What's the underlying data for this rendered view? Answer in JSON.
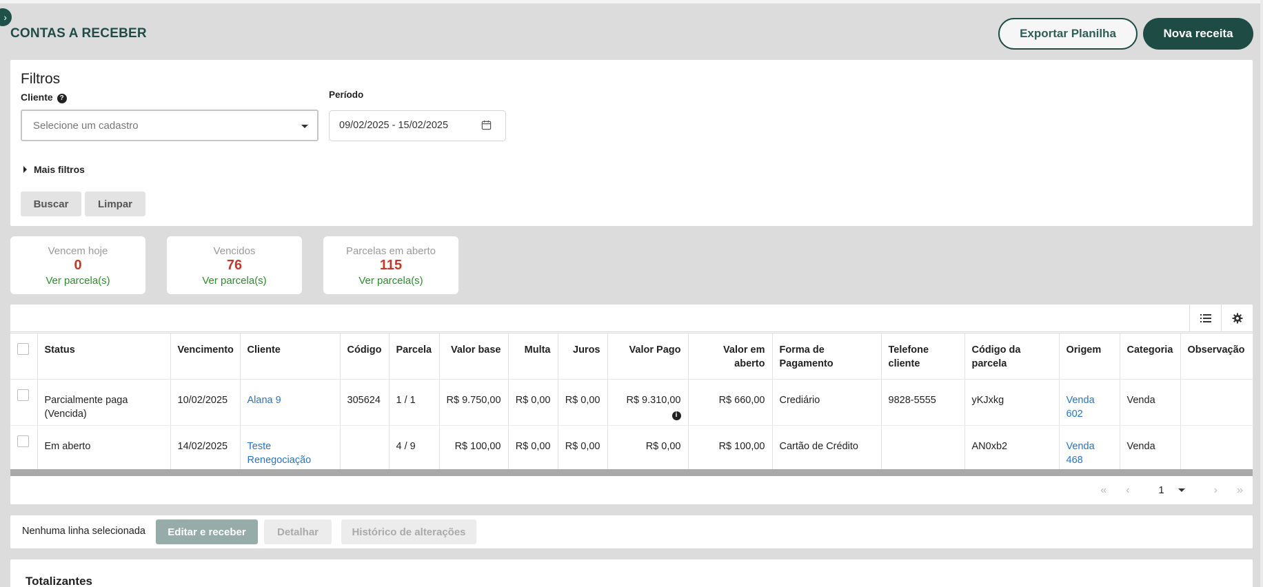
{
  "header": {
    "title": "CONTAS A RECEBER",
    "export_label": "Exportar Planilha",
    "new_label": "Nova receita"
  },
  "filters": {
    "title": "Filtros",
    "client_label": "Cliente",
    "client_placeholder": "Selecione um cadastro",
    "period_label": "Período",
    "period_value": "09/02/2025 - 15/02/2025",
    "more_filters_label": "Mais filtros",
    "search_label": "Buscar",
    "clear_label": "Limpar"
  },
  "stats": [
    {
      "label": "Vencem hoje",
      "value": "0",
      "link": "Ver parcela(s)"
    },
    {
      "label": "Vencidos",
      "value": "76",
      "link": "Ver parcela(s)"
    },
    {
      "label": "Parcelas em aberto",
      "value": "115",
      "link": "Ver parcela(s)"
    }
  ],
  "table": {
    "columns": [
      "Status",
      "Vencimento",
      "Cliente",
      "Código",
      "Parcela",
      "Valor base",
      "Multa",
      "Juros",
      "Valor Pago",
      "Valor em aberto",
      "Forma de Pagamento",
      "Telefone cliente",
      "Código da parcela",
      "Origem",
      "Categoria",
      "Observação"
    ],
    "rows": [
      {
        "status": "Parcialmente paga (Vencida)",
        "vencimento": "10/02/2025",
        "cliente": "Alana 9",
        "codigo": "305624",
        "parcela": "1 / 1",
        "valor_base": "R$ 9.750,00",
        "multa": "R$ 0,00",
        "juros": "R$ 0,00",
        "valor_pago": "R$ 9.310,00",
        "valor_aberto": "R$ 660,00",
        "forma_pagamento": "Crediário",
        "telefone": "9828-5555",
        "codigo_parcela": "yKJxkg",
        "origem": "Venda 602",
        "categoria": "Venda",
        "observacao": ""
      },
      {
        "status": "Em aberto",
        "vencimento": "14/02/2025",
        "cliente": "Teste Renegociação",
        "codigo": "",
        "parcela": "4 / 9",
        "valor_base": "R$ 100,00",
        "multa": "R$ 0,00",
        "juros": "R$ 0,00",
        "valor_pago": "R$ 0,00",
        "valor_aberto": "R$ 100,00",
        "forma_pagamento": "Cartão de Crédito",
        "telefone": "",
        "codigo_parcela": "AN0xb2",
        "origem": "Venda 468",
        "categoria": "Venda",
        "observacao": ""
      }
    ],
    "pagination": {
      "first": "«",
      "prev": "‹",
      "page": "1",
      "next": "›",
      "last": "»"
    },
    "toolbar_icons": [
      "list-icon",
      "gear-icon"
    ]
  },
  "actions": {
    "selection_text": "Nenhuma linha selecionada",
    "edit_label": "Editar e receber",
    "detail_label": "Detalhar",
    "history_label": "Histórico de alterações"
  },
  "totals": {
    "title": "Totalizantes"
  },
  "colors": {
    "brand": "#1e4c44",
    "danger": "#c0392b",
    "success": "#2e8b2e",
    "link": "#2a74c0"
  }
}
